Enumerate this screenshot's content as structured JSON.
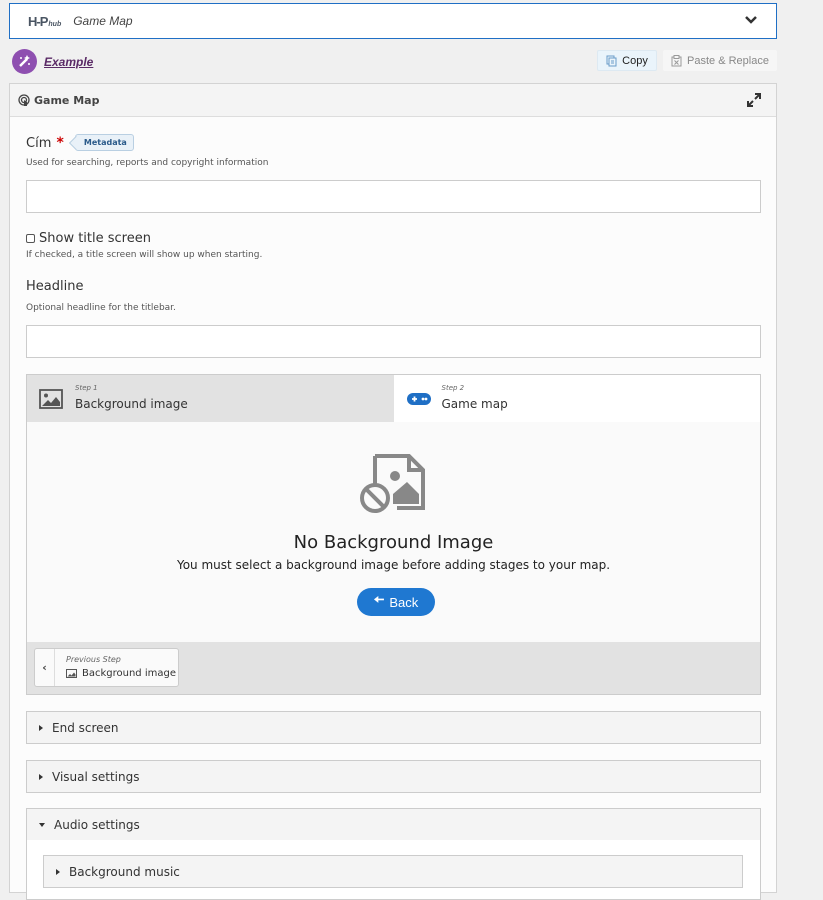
{
  "selector": {
    "logo_main": "H-P",
    "logo_sub": "hub",
    "title": "Game Map"
  },
  "example": {
    "label": "Example"
  },
  "toolbar": {
    "copy_label": "Copy",
    "paste_label": "Paste & Replace"
  },
  "panel": {
    "title": "Game Map"
  },
  "fields": {
    "title": {
      "label": "Cím",
      "required_mark": "*",
      "badge": "Metadata",
      "description": "Used for searching, reports and copyright information",
      "value": "",
      "placeholder": ""
    },
    "show_title_screen": {
      "label": "Show title screen",
      "checked": false,
      "description": "If checked, a title screen will show up when starting."
    },
    "headline": {
      "label": "Headline",
      "description": "Optional headline for the titlebar.",
      "value": "",
      "placeholder": ""
    }
  },
  "wizard": {
    "steps": [
      {
        "step": "Step 1",
        "name": "Background image",
        "icon": "image-icon",
        "active": true
      },
      {
        "step": "Step 2",
        "name": "Game map",
        "icon": "gamepad-icon",
        "active": false
      }
    ],
    "empty": {
      "icon": "no-image-icon",
      "title": "No Background Image",
      "text": "You must select a background image before adding stages to your map.",
      "back_label": "Back"
    },
    "previous": {
      "caption": "Previous Step",
      "name": "Background image"
    }
  },
  "sections": [
    {
      "label": "End screen",
      "expanded": false
    },
    {
      "label": "Visual settings",
      "expanded": false
    },
    {
      "label": "Audio settings",
      "expanded": true,
      "children": [
        {
          "label": "Background music",
          "expanded": false
        }
      ]
    }
  ],
  "colors": {
    "accent": "#1f78d1",
    "example_purple": "#8e4fb0",
    "required": "#cc0000"
  }
}
